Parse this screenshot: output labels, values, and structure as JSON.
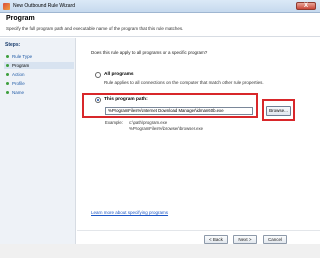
{
  "window": {
    "title": "New Outbound Rule Wizard",
    "close_glyph": "X"
  },
  "header": {
    "title": "Program",
    "subtitle": "Specify the full program path and executable name of the program that this rule matches."
  },
  "sidebar": {
    "title": "Steps:",
    "items": [
      {
        "label": "Rule Type",
        "active": false
      },
      {
        "label": "Program",
        "active": true
      },
      {
        "label": "Action",
        "active": false
      },
      {
        "label": "Profile",
        "active": false
      },
      {
        "label": "Name",
        "active": false
      }
    ]
  },
  "main": {
    "question": "Does this rule apply to all programs or a specific program?",
    "all_programs": {
      "label": "All programs",
      "description": "Rule applies to all connections on the computer that match other rule properties."
    },
    "this_program": {
      "label": "This program path:",
      "value": "%ProgramFiles%\\Internet Download Manager\\idman60b.exe",
      "browse_label": "Browse..."
    },
    "example": {
      "label": "Example:",
      "lines": [
        "c:\\path\\program.exe",
        "%ProgramFiles%\\browser\\browser.exe"
      ]
    },
    "learn_more": "Learn more about specifying programs"
  },
  "footer": {
    "back_label": "< Back",
    "next_label": "Next >",
    "cancel_label": "Cancel"
  },
  "colors": {
    "highlight": "#d8272a",
    "link": "#1a55c5"
  }
}
